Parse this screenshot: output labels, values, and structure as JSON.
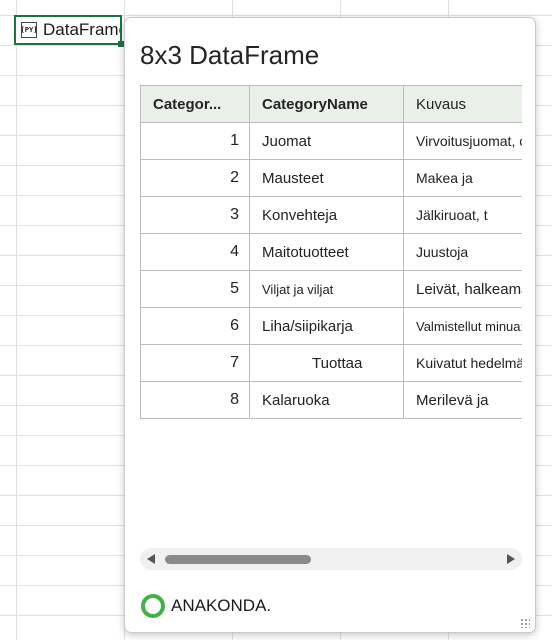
{
  "cell": {
    "icon_label": "[PY]",
    "text": "DataFrame"
  },
  "card": {
    "title": "8x3 DataFrame",
    "columns": [
      "Categor...",
      "CategoryName",
      "Kuvaus"
    ],
    "rows": [
      {
        "id": "1",
        "name": "Juomat",
        "desc": "Virvoitusjuomat, c"
      },
      {
        "id": "2",
        "name": "Mausteet",
        "desc": "Makea ja"
      },
      {
        "id": "3",
        "name": "Konvehteja",
        "desc": "Jälkiruoat, t"
      },
      {
        "id": "4",
        "name": "Maitotuotteet",
        "desc": "Juustoja"
      },
      {
        "id": "5",
        "name": "Viljat ja viljat",
        "desc": "Leivät, halkeama"
      },
      {
        "id": "6",
        "name": "Liha/siipikarja",
        "desc": "Valmistellut minua;"
      },
      {
        "id": "7",
        "name": "Tuottaa",
        "desc": "Kuivatut hedelmät"
      },
      {
        "id": "8",
        "name": "Kalaruoka",
        "desc": "Merilevä ja"
      }
    ],
    "footer_text": "ANAKONDA."
  },
  "colors": {
    "accent_green": "#1f7145",
    "header_bg": "#e8f0e8",
    "anaconda_green": "#43b049"
  }
}
